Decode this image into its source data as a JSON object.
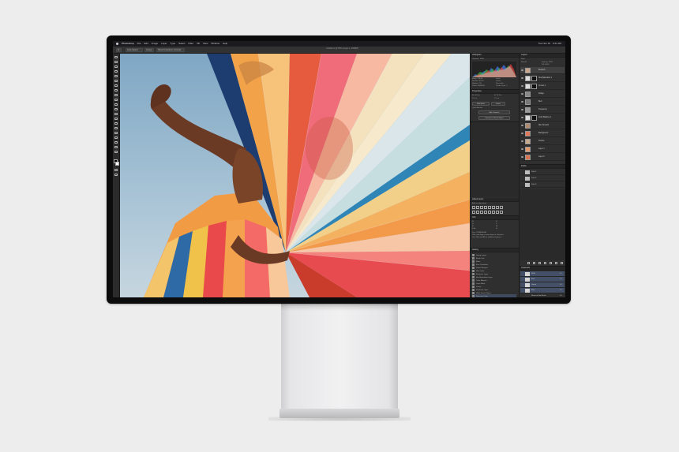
{
  "menubar": {
    "items": [
      "Photoshop",
      "File",
      "Edit",
      "Image",
      "Layer",
      "Type",
      "Select",
      "Filter",
      "3D",
      "View",
      "Window",
      "Help"
    ],
    "status": [
      "Tue Nov 19",
      "9:41 AM"
    ]
  },
  "options_bar": {
    "tool_preset": "Auto-Select:",
    "layer_dropdown": "Group",
    "transform": "Show Transform Controls",
    "document_title": "Untitled-1 @ 50% (Layer 1, RGB/8)"
  },
  "panels": {
    "histogram": {
      "title": "Histogram",
      "channel_label": "Channel:",
      "channel": "RGB",
      "stats": [
        "Mean: 118.04",
        "Std Dev: 62.10",
        "Median: 114",
        "Pixels: 2846208"
      ],
      "stats_right": [
        "Level:",
        "Count:",
        "Percentile:",
        "Cache Level: 1"
      ]
    },
    "properties": {
      "title": "Properties",
      "rows": [
        "W: 24.3 in",
        "H: 16.2 in",
        "X: 0 in",
        "Y: 0 in"
      ],
      "buttons": [
        "Edit Mask",
        "Invert"
      ],
      "section": "Quick Actions",
      "actions": [
        "Edit Contents",
        "Convert to Smart Object"
      ]
    },
    "adjustments": {
      "title": "Adjustments",
      "subtitle": "Add an adjustment"
    },
    "info": {
      "title": "Info",
      "lines": [
        "R:",
        "G:",
        "B:",
        "8-bit",
        "X:",
        "Y:",
        "W:",
        "H:",
        "Doc: 22.8M/48.3M",
        "Click and drag to move layer or selection.",
        "Use Shift and Alt for additional options."
      ]
    },
    "history": {
      "title": "History",
      "items": [
        "Group Layers",
        "Brush Tool",
        "Move",
        "Free Transform",
        "Smart Sharpen",
        "New Layer",
        "Rasterize Layer",
        "Hue/Saturation Layer",
        "Color Balance",
        "Layer Mask",
        "Levels",
        "Duplicate Layer",
        "Make Smart Object",
        "Selective Color"
      ]
    },
    "layers": {
      "title": "Layers",
      "kind": "Kind",
      "blend": "Normal",
      "opacity": "Opacity: 100%",
      "fill": "Fill: 100%",
      "items": [
        "Retouch",
        "Hue/Saturation 1",
        "Curves 1",
        "Dodge",
        "Burn",
        "Frequency",
        "Color Balance 1",
        "Skin Smooth",
        "Background",
        "Texture",
        "Layer 1",
        "Layer 0"
      ]
    },
    "paths": {
      "title": "Paths",
      "items": [
        "Path 1",
        "Path 2",
        "Path 3"
      ]
    },
    "channels": {
      "title": "Channels",
      "items": [
        {
          "name": "RGB",
          "key": "⌘2"
        },
        {
          "name": "Red",
          "key": "⌘3"
        },
        {
          "name": "Green",
          "key": "⌘4"
        },
        {
          "name": "Blue",
          "key": "⌘5"
        },
        {
          "name": "Retouch Hair Mask",
          "key": "⌘6"
        }
      ]
    }
  },
  "colors": {
    "background": "#ededed",
    "bezel": "#0c0c0d",
    "panel": "#2f2f2f",
    "selection": "#445067"
  }
}
